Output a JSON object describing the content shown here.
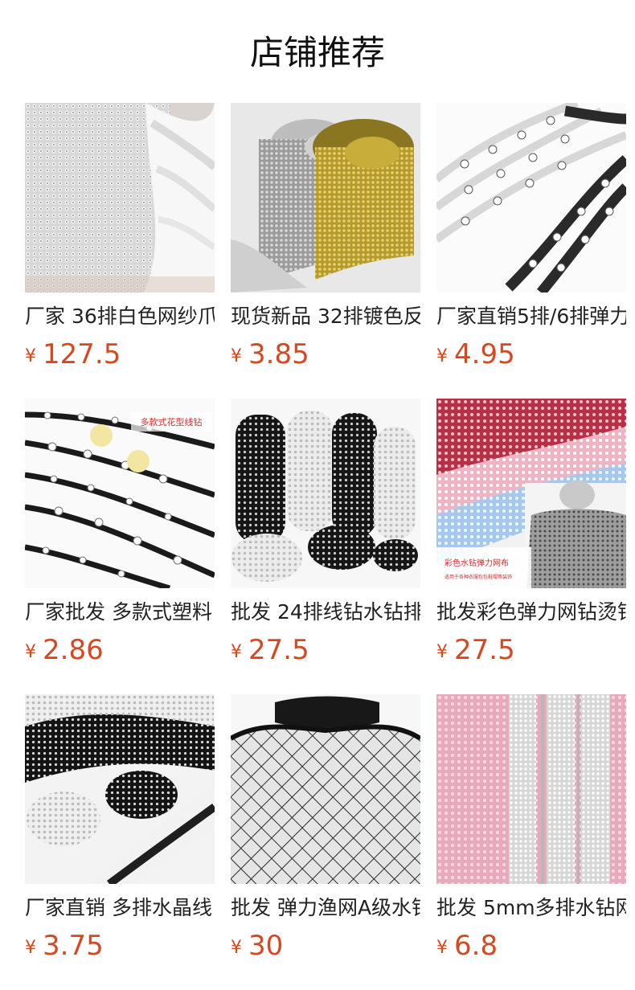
{
  "page": {
    "title": "店铺推荐"
  },
  "products": [
    {
      "name": "厂家 36排白色网纱爪",
      "currency": "¥",
      "price": "127.5",
      "image_icon": "white-rhinestone-mesh-roll-image"
    },
    {
      "name": "现货新品 32排镀色反",
      "currency": "¥",
      "price": "3.85",
      "image_icon": "silver-gold-mesh-rolls-image"
    },
    {
      "name": "厂家直销5排/6排弹力",
      "currency": "¥",
      "price": "4.95",
      "image_icon": "clear-black-rhinestone-chains-image"
    },
    {
      "name": "厂家批发 多款式塑料",
      "currency": "¥",
      "price": "2.86",
      "image_icon": "flower-rhinestone-trim-image",
      "overlay_text": "多款式花型线钻"
    },
    {
      "name": "批发 24排线钻水钻排",
      "currency": "¥",
      "price": "27.5",
      "image_icon": "black-white-rhinestone-rolls-image"
    },
    {
      "name": "批发彩色弹力网钻烫钻",
      "currency": "¥",
      "price": "27.5",
      "image_icon": "colored-stretch-mesh-image",
      "overlay_title": "彩色水钻弹力网布",
      "overlay_subtitle": "适用于各种衣服包包鞋帽等装饰"
    },
    {
      "name": "厂家直销 多排水晶线",
      "currency": "¥",
      "price": "3.75",
      "image_icon": "multi-row-crystal-trim-image"
    },
    {
      "name": "批发 弹力渔网A级水钻",
      "currency": "¥",
      "price": "30",
      "image_icon": "fishnet-mesh-top-image"
    },
    {
      "name": "批发 5mm多排水钻网",
      "currency": "¥",
      "price": "6.8",
      "image_icon": "pink-rhinestone-mesh-image"
    }
  ]
}
